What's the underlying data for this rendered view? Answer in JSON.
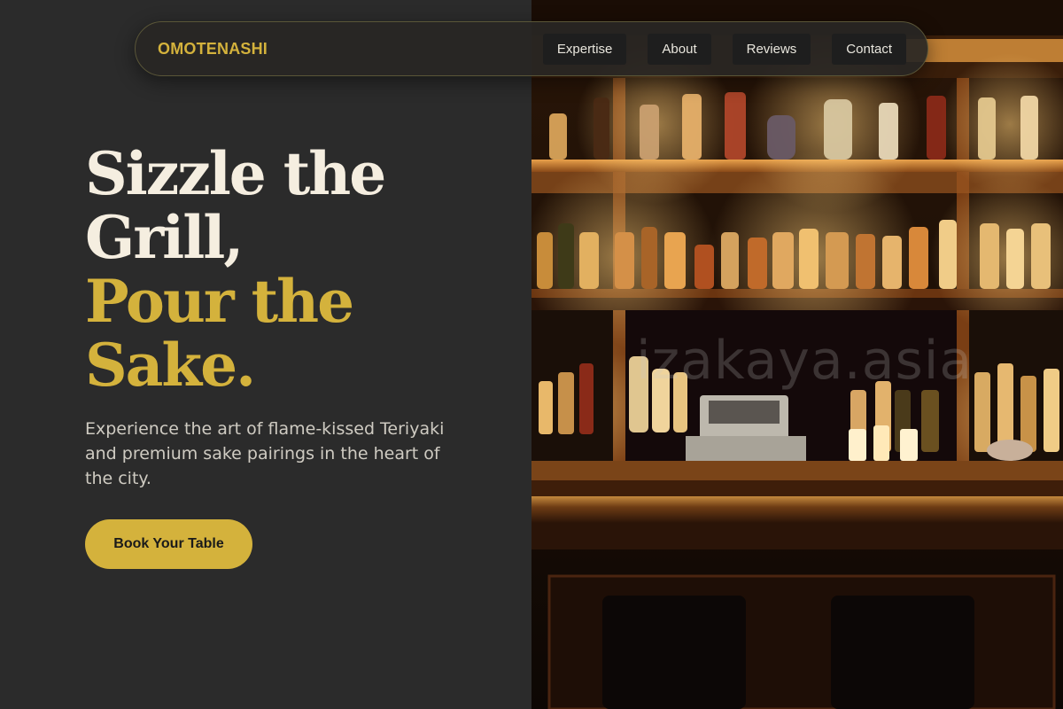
{
  "nav": {
    "brand": "OMOTENASHI",
    "links": [
      {
        "label": "Expertise"
      },
      {
        "label": "About"
      },
      {
        "label": "Reviews"
      },
      {
        "label": "Contact"
      }
    ]
  },
  "hero": {
    "headline_line1": "Sizzle the Grill,",
    "headline_line2": "Pour the Sake.",
    "subtitle": "Experience the art of flame-kissed Teriyaki and premium sake pairings in the heart of the city.",
    "cta_label": "Book Your Table"
  },
  "image": {
    "description_name": "bar-shelves-photo",
    "watermark": "izakaya.asia"
  },
  "colors": {
    "accent": "#d4b23c",
    "background": "#2b2b2b",
    "headline": "#f5eee0",
    "text": "#cfcbc2"
  }
}
